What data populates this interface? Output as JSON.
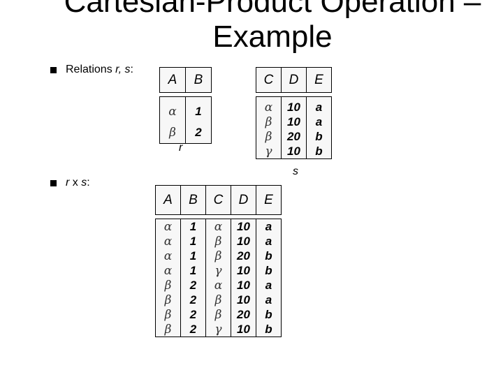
{
  "slide": {
    "title_line1": "Cartesian-Product Operation –",
    "title_line2": "Example"
  },
  "bullets": [
    {
      "prefix": "Relations ",
      "italic": "r, s",
      "suffix": ":"
    },
    {
      "prefix": "",
      "italic": "r",
      "middle": " x ",
      "italic2": "s",
      "suffix": ":"
    }
  ],
  "relation_r": {
    "label": "r",
    "columns": [
      "A",
      "B"
    ],
    "rows": [
      [
        "α",
        "1"
      ],
      [
        "β",
        "2"
      ]
    ]
  },
  "relation_s": {
    "label": "s",
    "columns": [
      "C",
      "D",
      "E"
    ],
    "rows": [
      [
        "α",
        "10",
        "a"
      ],
      [
        "β",
        "10",
        "a"
      ],
      [
        "β",
        "20",
        "b"
      ],
      [
        "γ",
        "10",
        "b"
      ]
    ]
  },
  "relation_rxs": {
    "columns": [
      "A",
      "B",
      "C",
      "D",
      "E"
    ],
    "rows": [
      [
        "α",
        "1",
        "α",
        "10",
        "a"
      ],
      [
        "α",
        "1",
        "β",
        "10",
        "a"
      ],
      [
        "α",
        "1",
        "β",
        "20",
        "b"
      ],
      [
        "α",
        "1",
        "γ",
        "10",
        "b"
      ],
      [
        "β",
        "2",
        "α",
        "10",
        "a"
      ],
      [
        "β",
        "2",
        "β",
        "10",
        "a"
      ],
      [
        "β",
        "2",
        "β",
        "20",
        "b"
      ],
      [
        "β",
        "2",
        "γ",
        "10",
        "b"
      ]
    ]
  }
}
